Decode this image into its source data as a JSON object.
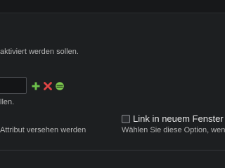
{
  "help": {
    "activate_text": "aktiviert werden sollen.",
    "ident_text": "llen.",
    "attribute_text": "Attribut versehen werden"
  },
  "input": {
    "value": ""
  },
  "actions": {
    "add_icon": "plus-icon",
    "remove_icon": "x-icon",
    "sort_icon": "drag-handle-icon"
  },
  "new_window": {
    "label": "Link in neuem Fenster",
    "help": "Wählen Sie diese Option, wen",
    "checked": false
  },
  "colors": {
    "background": "#1d1f21",
    "add": "#6cc04a",
    "remove": "#e04545",
    "sort": "#7cc84e"
  }
}
